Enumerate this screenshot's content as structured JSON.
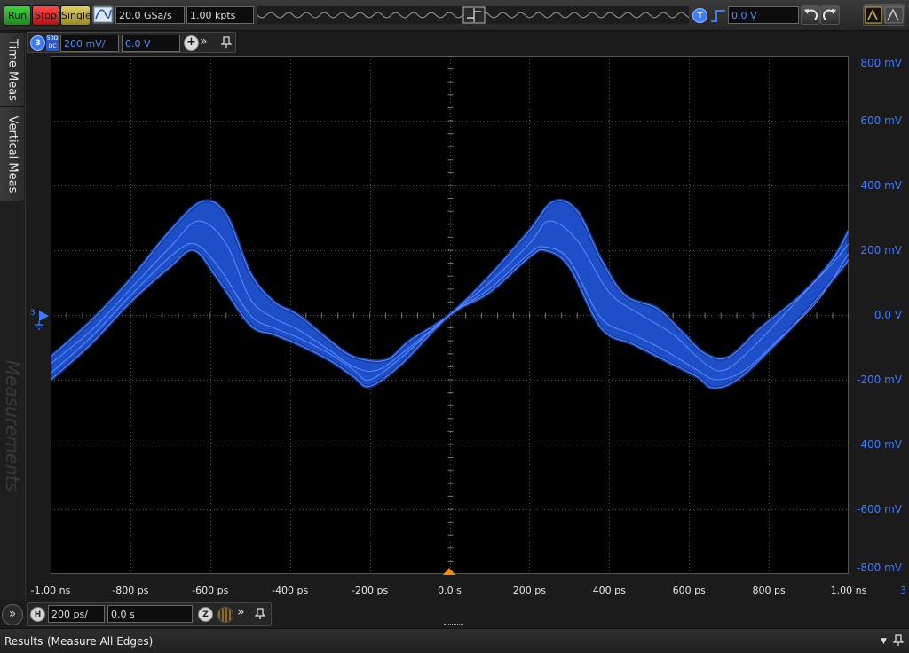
{
  "toolbar": {
    "run_label": "Run",
    "stop_label": "Stop",
    "single_label": "Single",
    "sample_rate": "20.0 GSa/s",
    "memory_depth": "1.00 kpts",
    "trigger_badge": "T",
    "trigger_level": "0.0 V",
    "icons": [
      "autoscale-icon",
      "trigger-edge-icon",
      "undo-icon",
      "redo-icon",
      "measure-icon"
    ]
  },
  "sidetabs": {
    "time_meas": "Time Meas",
    "vertical_meas": "Vertical Meas",
    "watermark": "Measurements"
  },
  "channel": {
    "number": "3",
    "coupling_top": "50Ω",
    "coupling_bottom": "DC",
    "scale": "200 mV/",
    "offset": "0.0 V"
  },
  "timebase": {
    "badge": "H",
    "scale": "200 ps/",
    "position": "0.0 s",
    "zoom_badge": "Z"
  },
  "results": {
    "label": "Results",
    "mode": "(Measure All Edges)"
  },
  "colors": {
    "trace": "#1e4fc9",
    "trace_line": "#5a8cff",
    "axis_label": "#3d7bff",
    "trigger_marker": "#ff8c00"
  },
  "chart_data": {
    "type": "line",
    "title": "",
    "xlabel": "",
    "ylabel": "",
    "xlim": [
      -1000,
      1000
    ],
    "ylim": [
      -800,
      800
    ],
    "x_unit": "ps",
    "y_unit": "mV",
    "grid": true,
    "x_ticks": [
      -1000,
      -800,
      -600,
      -400,
      -200,
      0,
      200,
      400,
      600,
      800,
      1000
    ],
    "x_tick_labels": [
      "-1.00 ns",
      "-800 ps",
      "-600 ps",
      "-400 ps",
      "-200 ps",
      "0.0 s",
      "200 ps",
      "400 ps",
      "600 ps",
      "800 ps",
      "1.00 ns"
    ],
    "y_ticks": [
      800,
      600,
      400,
      200,
      0,
      -200,
      -400,
      -600,
      -800
    ],
    "y_tick_labels": [
      "800 mV",
      "600 mV",
      "400 mV",
      "200 mV",
      "0.0 V",
      "-200 mV",
      "-400 mV",
      "-600 mV",
      "-800 mV"
    ],
    "channel_marker": "3",
    "series": [
      {
        "kind": "envelope",
        "upper": [
          [
            -1000,
            -130
          ],
          [
            -900,
            -20
          ],
          [
            -800,
            110
          ],
          [
            -700,
            260
          ],
          [
            -620,
            350
          ],
          [
            -560,
            310
          ],
          [
            -500,
            130
          ],
          [
            -440,
            40
          ],
          [
            -380,
            0
          ],
          [
            -300,
            -80
          ],
          [
            -240,
            -130
          ],
          [
            -160,
            -140
          ],
          [
            -100,
            -80
          ],
          [
            0,
            0
          ],
          [
            100,
            120
          ],
          [
            200,
            260
          ],
          [
            260,
            350
          ],
          [
            320,
            320
          ],
          [
            380,
            170
          ],
          [
            440,
            60
          ],
          [
            520,
            20
          ],
          [
            580,
            -50
          ],
          [
            640,
            -120
          ],
          [
            700,
            -130
          ],
          [
            780,
            -40
          ],
          [
            880,
            60
          ],
          [
            960,
            170
          ],
          [
            1000,
            260
          ]
        ],
        "lower": [
          [
            -1000,
            -200
          ],
          [
            -900,
            -90
          ],
          [
            -800,
            40
          ],
          [
            -700,
            150
          ],
          [
            -640,
            200
          ],
          [
            -580,
            110
          ],
          [
            -500,
            -30
          ],
          [
            -440,
            -60
          ],
          [
            -380,
            -90
          ],
          [
            -300,
            -140
          ],
          [
            -240,
            -190
          ],
          [
            -200,
            -220
          ],
          [
            -120,
            -150
          ],
          [
            0,
            0
          ],
          [
            100,
            70
          ],
          [
            200,
            180
          ],
          [
            240,
            200
          ],
          [
            300,
            150
          ],
          [
            380,
            -40
          ],
          [
            460,
            -90
          ],
          [
            540,
            -140
          ],
          [
            620,
            -190
          ],
          [
            660,
            -225
          ],
          [
            720,
            -200
          ],
          [
            800,
            -110
          ],
          [
            900,
            20
          ],
          [
            1000,
            170
          ]
        ]
      },
      {
        "kind": "trace",
        "values": [
          [
            -1000,
            -150
          ],
          [
            -900,
            -50
          ],
          [
            -800,
            80
          ],
          [
            -700,
            210
          ],
          [
            -630,
            290
          ],
          [
            -560,
            220
          ],
          [
            -500,
            50
          ],
          [
            -440,
            -10
          ],
          [
            -380,
            -45
          ],
          [
            -300,
            -110
          ],
          [
            -240,
            -160
          ],
          [
            -180,
            -170
          ],
          [
            -100,
            -100
          ],
          [
            0,
            0
          ],
          [
            100,
            100
          ],
          [
            200,
            220
          ],
          [
            250,
            290
          ],
          [
            320,
            230
          ],
          [
            400,
            70
          ],
          [
            480,
            0
          ],
          [
            560,
            -60
          ],
          [
            640,
            -150
          ],
          [
            690,
            -170
          ],
          [
            760,
            -100
          ],
          [
            860,
            30
          ],
          [
            960,
            160
          ],
          [
            1000,
            220
          ]
        ]
      },
      {
        "kind": "trace",
        "values": [
          [
            -1000,
            -180
          ],
          [
            -900,
            -70
          ],
          [
            -800,
            60
          ],
          [
            -700,
            180
          ],
          [
            -640,
            220
          ],
          [
            -580,
            150
          ],
          [
            -500,
            0
          ],
          [
            -440,
            -40
          ],
          [
            -380,
            -70
          ],
          [
            -300,
            -120
          ],
          [
            -240,
            -170
          ],
          [
            -200,
            -200
          ],
          [
            -120,
            -130
          ],
          [
            0,
            0
          ],
          [
            100,
            80
          ],
          [
            200,
            190
          ],
          [
            240,
            210
          ],
          [
            300,
            170
          ],
          [
            380,
            -10
          ],
          [
            460,
            -60
          ],
          [
            540,
            -110
          ],
          [
            620,
            -170
          ],
          [
            670,
            -200
          ],
          [
            740,
            -170
          ],
          [
            820,
            -80
          ],
          [
            920,
            40
          ],
          [
            1000,
            190
          ]
        ]
      }
    ]
  }
}
